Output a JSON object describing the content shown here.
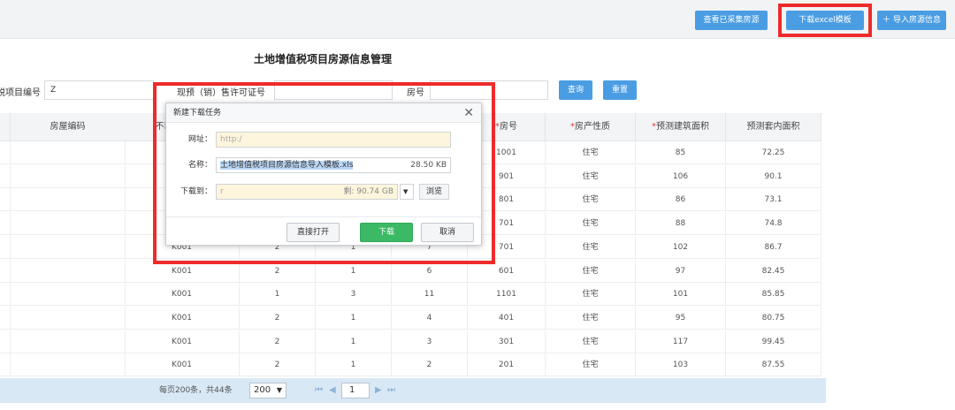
{
  "toolbar": {
    "view_collected": "查看已采集房源",
    "download_template": "下载excel模板",
    "import": "导入房源信息",
    "import_icon": "plus-icon"
  },
  "page": {
    "title": "土地增值税项目房源信息管理"
  },
  "filters": {
    "project_no_label": "税项目编号",
    "project_no_value": "Z",
    "permit_label": "现预（销）售许可证号",
    "permit_value": "",
    "room_label": "房号",
    "room_value": "",
    "query": "查询",
    "reset": "重置"
  },
  "table": {
    "headers": [
      "房屋编码",
      "不动产单元号",
      "",
      "",
      "",
      "房号",
      "房产性质",
      "预测建筑面积",
      "预测套内面积"
    ],
    "required": [
      false,
      false,
      false,
      false,
      false,
      true,
      true,
      true,
      false
    ],
    "rows": [
      [
        "",
        "",
        "",
        "",
        "",
        "1001",
        "住宅",
        "85",
        "72.25"
      ],
      [
        "",
        "",
        "",
        "",
        "",
        "901",
        "住宅",
        "106",
        "90.1"
      ],
      [
        "",
        "",
        "",
        "",
        "",
        "801",
        "住宅",
        "86",
        "73.1"
      ],
      [
        "",
        "",
        "",
        "",
        "",
        "701",
        "住宅",
        "88",
        "74.8"
      ],
      [
        "",
        "K001",
        "2",
        "1",
        "7",
        "701",
        "住宅",
        "102",
        "86.7"
      ],
      [
        "",
        "K001",
        "2",
        "1",
        "6",
        "601",
        "住宅",
        "97",
        "82.45"
      ],
      [
        "",
        "K001",
        "1",
        "3",
        "11",
        "1101",
        "住宅",
        "101",
        "85.85"
      ],
      [
        "",
        "K001",
        "2",
        "1",
        "4",
        "401",
        "住宅",
        "95",
        "80.75"
      ],
      [
        "",
        "K001",
        "2",
        "1",
        "3",
        "301",
        "住宅",
        "117",
        "99.45"
      ],
      [
        "",
        "K001",
        "2",
        "1",
        "2",
        "201",
        "住宅",
        "103",
        "87.55"
      ]
    ]
  },
  "pager": {
    "summary": "每页200条，共44条",
    "page_size": "200",
    "current_page": "1"
  },
  "dialog": {
    "title": "新建下载任务",
    "url_label": "网址：",
    "url_value": "http:/",
    "name_label": "名称：",
    "name_value": "土地增值税项目房源信息导入模板.xls",
    "name_size": "28.50 KB",
    "save_label": "下载到：",
    "save_value": "r",
    "free_space": "剩: 90.74 GB",
    "browse": "浏览",
    "open": "直接打开",
    "download": "下载",
    "cancel": "取消"
  },
  "colors": {
    "accent": "#4a9de3",
    "highlight": "#ee2b2b",
    "green": "#3cb964",
    "required": "#e23b3b"
  }
}
